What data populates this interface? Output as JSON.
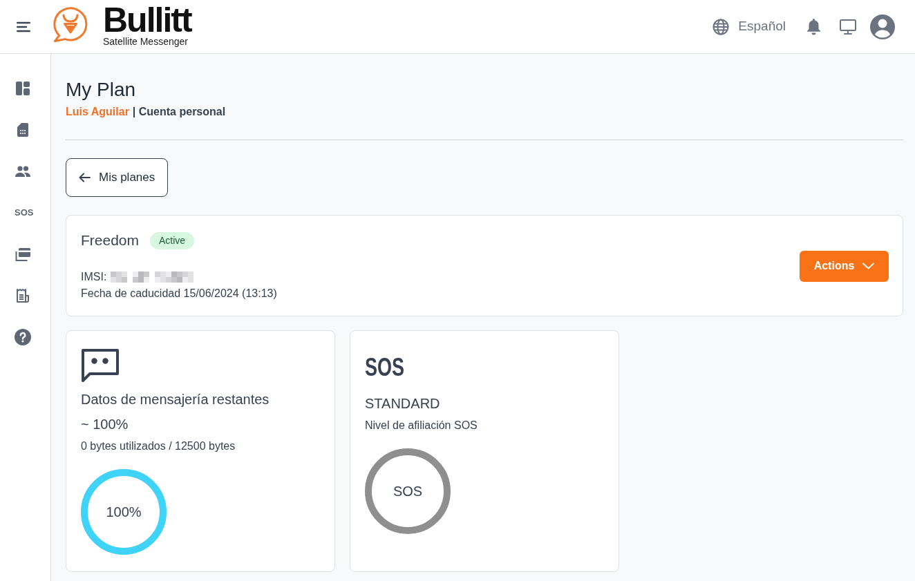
{
  "header": {
    "logo": {
      "name": "Bullitt",
      "tagline": "Satellite Messenger"
    },
    "language": "Español"
  },
  "sidebar": {
    "items": [
      {
        "kind": "icon"
      },
      {
        "kind": "icon"
      },
      {
        "kind": "icon"
      },
      {
        "kind": "text",
        "label": "SOS"
      },
      {
        "kind": "icon"
      },
      {
        "kind": "icon"
      },
      {
        "kind": "icon"
      }
    ]
  },
  "page": {
    "title": "My Plan",
    "user": "Luis Aguilar",
    "account": "| Cuenta personal",
    "back_button": "Mis planes"
  },
  "plan": {
    "name": "Freedom",
    "status": "Active",
    "imsi_label": "IMSI:",
    "expiry": "Fecha de caducidad 15/06/2024 (13:13)",
    "actions_button": "Actions"
  },
  "stats": [
    {
      "kind": "data",
      "title": "Datos de mensajería restantes",
      "value": "~ 100%",
      "detail": "0 bytes utilizados / 12500 bytes",
      "ring": {
        "label": "100%",
        "level": 1,
        "color": "#3fd3f8"
      }
    },
    {
      "kind": "sos",
      "logo": "SOS",
      "title": "STANDARD",
      "detail": "Nivel de afiliación SOS",
      "ring": {
        "label": "SOS",
        "color": "#8f8f8f"
      }
    }
  ]
}
